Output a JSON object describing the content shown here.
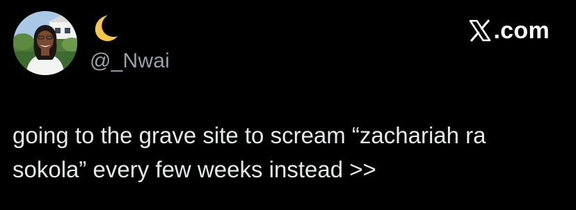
{
  "author": {
    "display_name_icon": "crescent-moon-icon",
    "handle": "@_Nwai",
    "avatar_icon": "profile-photo"
  },
  "watermark": {
    "logo_icon": "x-logo-icon",
    "text": ".com"
  },
  "tweet": {
    "lines": [
      "going to the grave site to scream “zachariah ra",
      "sokola” every few weeks instead >>"
    ]
  },
  "colors": {
    "background": "#000000",
    "text": "#e7e9ea",
    "handle": "#9aa0a6",
    "moon": "#f5c64a"
  }
}
